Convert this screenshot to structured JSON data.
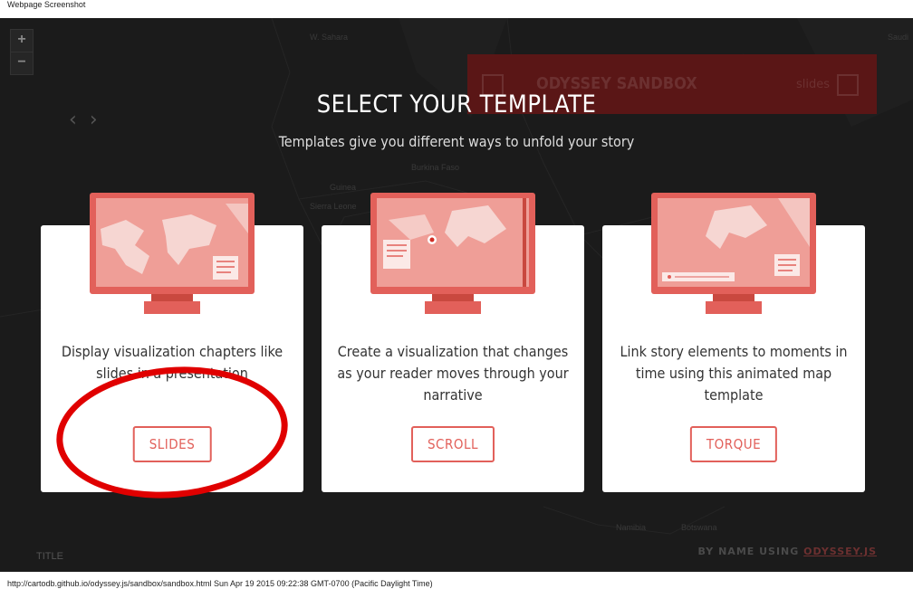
{
  "page": {
    "top_caption": "Webpage Screenshot",
    "bottom_caption": "http://cartodb.github.io/odyssey.js/sandbox/sandbox.html Sun Apr 19 2015 09:22:38 GMT-0700 (Pacific Daylight Time)"
  },
  "map": {
    "zoom_in": "+",
    "zoom_out": "−",
    "labels": [
      "W. Sahara",
      "Burkina Faso",
      "Guinea",
      "Sierra Leone",
      "Namibia",
      "Botswana",
      "Saudi"
    ],
    "prev_arrow": "‹",
    "next_arrow": "›"
  },
  "background_app": {
    "title": "ODYSSEY SANDBOX",
    "mode_label": "slides",
    "story_title": "TITLE",
    "credit_prefix": "BY NAME USING",
    "credit_link": "ODYSSEY.JS"
  },
  "modal": {
    "heading": "SELECT YOUR TEMPLATE",
    "subheading": "Templates give you different ways to unfold your story",
    "templates": [
      {
        "description": "Display visualization chapters like slides in a presentation",
        "button": "SLIDES"
      },
      {
        "description": "Create a visualization that changes as your reader moves through your narrative",
        "button": "SCROLL"
      },
      {
        "description": "Link story elements to moments in time using this animated map template",
        "button": "TORQUE"
      }
    ]
  },
  "colors": {
    "accent": "#e2605a",
    "annotation_circle": "#e00000",
    "overlay": "#1b1b1b"
  }
}
